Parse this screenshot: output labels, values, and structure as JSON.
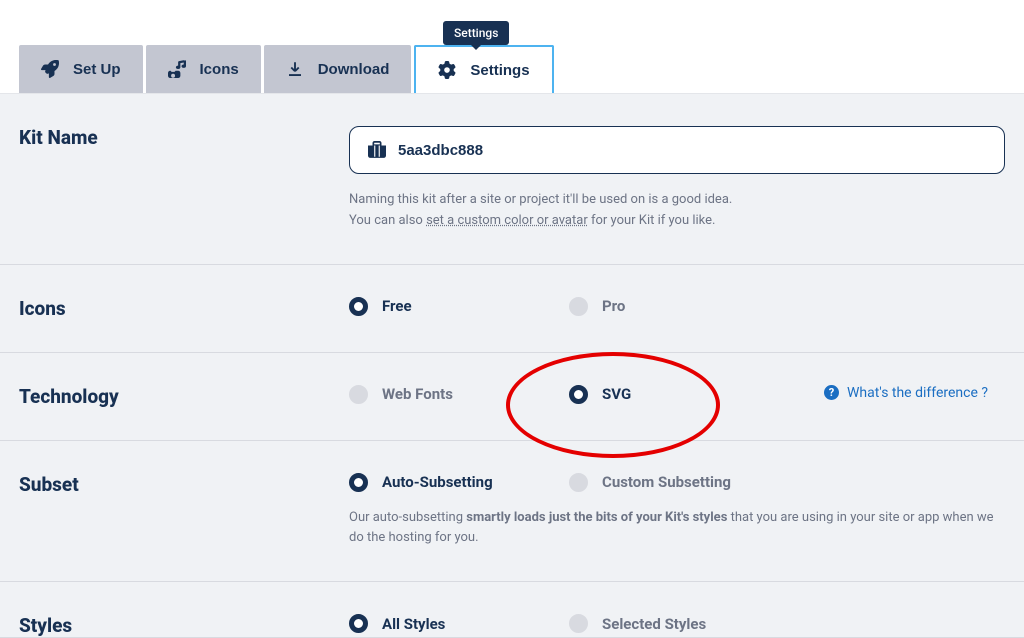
{
  "tooltip": "Settings",
  "tabs": {
    "setup": {
      "label": "Set Up"
    },
    "icons": {
      "label": "Icons"
    },
    "download": {
      "label": "Download"
    },
    "settings": {
      "label": "Settings"
    }
  },
  "sections": {
    "kitName": {
      "title": "Kit Name",
      "value": "5aa3dbc888",
      "helper1": "Naming this kit after a site or project it'll be used on is a good idea.",
      "helper2a": "You can also ",
      "helper2link": "set a custom color or avatar",
      "helper2b": " for your Kit if you like."
    },
    "icons": {
      "title": "Icons",
      "free": "Free",
      "pro": "Pro"
    },
    "technology": {
      "title": "Technology",
      "webfonts": "Web Fonts",
      "svg": "SVG",
      "help": "What's the difference ?"
    },
    "subset": {
      "title": "Subset",
      "auto": "Auto-Subsetting",
      "custom": "Custom Subsetting",
      "description1": "Our auto-subsetting ",
      "description_strong": "smartly loads just the bits of your Kit's styles",
      "description2": " that you are using in your site or app when we do the hosting for you."
    },
    "styles": {
      "title": "Styles",
      "all": "All Styles",
      "selected": "Selected Styles"
    }
  }
}
